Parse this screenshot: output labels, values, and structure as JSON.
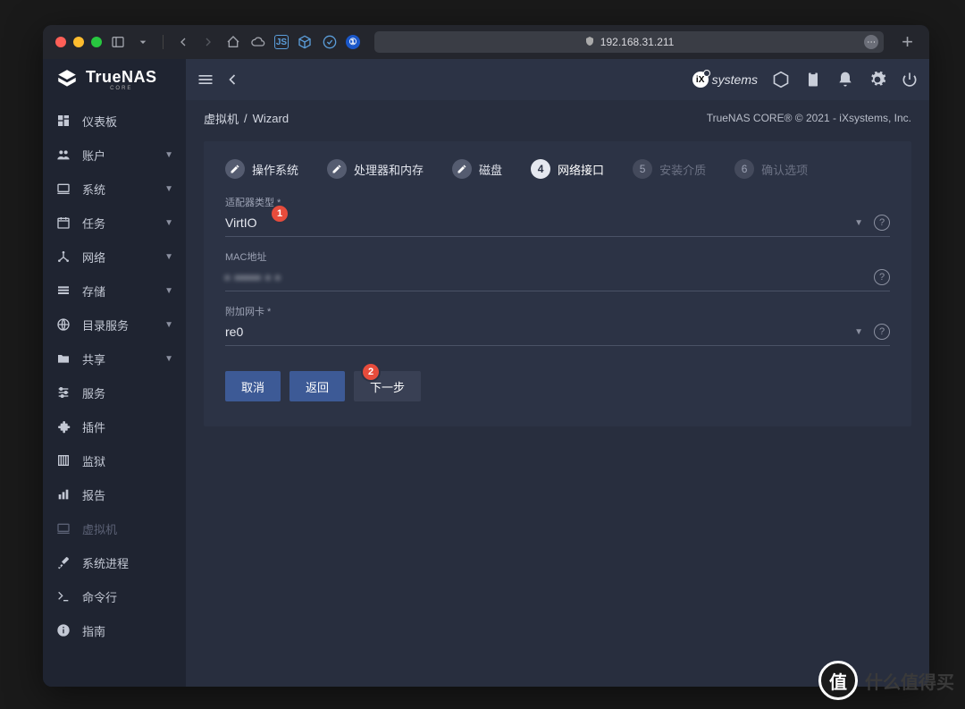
{
  "browser": {
    "url": "192.168.31.211"
  },
  "branding": {
    "name": "TrueNAS",
    "edition": "CORE",
    "vendor": "systems"
  },
  "footer_copyright": "TrueNAS CORE® © 2021 - iXsystems, Inc.",
  "breadcrumb": {
    "root": "虚拟机",
    "sep": "/",
    "current": "Wizard"
  },
  "sidebar": [
    {
      "icon": "dashboard",
      "label": "仪表板",
      "expandable": false
    },
    {
      "icon": "people",
      "label": "账户",
      "expandable": true
    },
    {
      "icon": "laptop",
      "label": "系统",
      "expandable": true
    },
    {
      "icon": "calendar",
      "label": "任务",
      "expandable": true
    },
    {
      "icon": "network",
      "label": "网络",
      "expandable": true
    },
    {
      "icon": "list",
      "label": "存储",
      "expandable": true
    },
    {
      "icon": "globe",
      "label": "目录服务",
      "expandable": true
    },
    {
      "icon": "folder",
      "label": "共享",
      "expandable": true
    },
    {
      "icon": "tune",
      "label": "服务",
      "expandable": false
    },
    {
      "icon": "puzzle",
      "label": "插件",
      "expandable": false
    },
    {
      "icon": "jail",
      "label": "监狱",
      "expandable": false
    },
    {
      "icon": "bars",
      "label": "报告",
      "expandable": false
    },
    {
      "icon": "laptop",
      "label": "虚拟机",
      "expandable": false,
      "dim": true
    },
    {
      "icon": "wrench",
      "label": "系统进程",
      "expandable": false
    },
    {
      "icon": "terminal",
      "label": "命令行",
      "expandable": false
    },
    {
      "icon": "info",
      "label": "指南",
      "expandable": false
    }
  ],
  "steps": [
    {
      "label": "操作系统",
      "state": "done"
    },
    {
      "label": "处理器和内存",
      "state": "done"
    },
    {
      "label": "磁盘",
      "state": "done"
    },
    {
      "label": "网络接口",
      "state": "active",
      "num": "4"
    },
    {
      "label": "安装介质",
      "state": "dim",
      "num": "5"
    },
    {
      "label": "确认选项",
      "state": "dim",
      "num": "6"
    }
  ],
  "form": {
    "adapter_label": "适配器类型 *",
    "adapter_value": "VirtIO",
    "mac_label": "MAC地址",
    "mac_value": "▪ ▪▪▪▪▪ ▪ ▪",
    "nic_label": "附加网卡 *",
    "nic_value": "re0"
  },
  "buttons": {
    "cancel": "取消",
    "back": "返回",
    "next": "下一步"
  },
  "badges": {
    "b1": "1",
    "b2": "2"
  },
  "watermark": {
    "char": "值",
    "text": "什么值得买"
  }
}
